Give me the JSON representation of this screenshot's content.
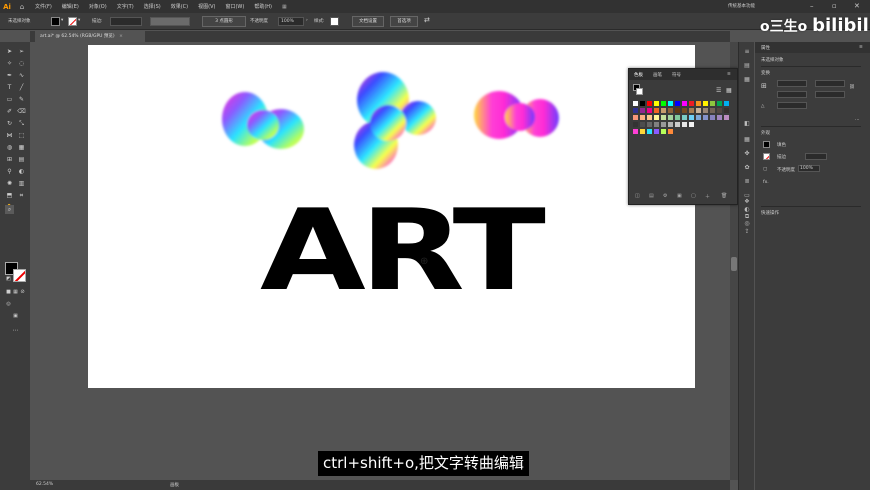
{
  "menubar": {
    "logo": "Ai",
    "items": [
      "文件(F)",
      "编辑(E)",
      "对象(O)",
      "文字(T)",
      "选择(S)",
      "效果(C)",
      "视图(V)",
      "窗口(W)",
      "帮助(H)"
    ],
    "workspace": "传统基本功能"
  },
  "control_bar": {
    "selection_label": "未选择对象",
    "stroke_label": "描边:",
    "brush_label": "3 点圆形",
    "opacity_label": "不透明度",
    "opacity_value": "100%",
    "style_label": "样式:",
    "doc_setup_button": "文档设置",
    "prefs_button": "首选项"
  },
  "document": {
    "tab_title": "art.ai* @ 62.54% (RGB/GPU 预览)",
    "close_glyph": "×",
    "artwork_text": "ART",
    "zoom": "62.54%",
    "artboard_label": "画板"
  },
  "properties_panel": {
    "title": "属性",
    "no_selection": "未选择对象",
    "transform": "变换",
    "appearance": "外观",
    "fill": "填色",
    "stroke": "描边",
    "opacity": "不透明度",
    "opacity_value": "100%",
    "fx": "fx.",
    "quick_actions": "快速操作"
  },
  "swatches_panel": {
    "tabs": [
      "色板",
      "画笔",
      "符号"
    ]
  },
  "subtitle": "ctrl+shift+o,把文字转曲编辑",
  "watermark": "bilibili"
}
